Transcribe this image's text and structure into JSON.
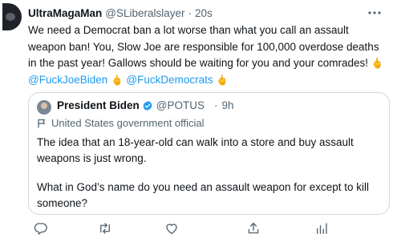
{
  "tweet": {
    "author_name": "UltraMagaMan",
    "author_handle": "@SLiberalslayer",
    "separator": "·",
    "timestamp": "20s",
    "text_main": "We need a Democrat ban a lot worse than what you call an assault weapon ban! You, Slow Joe are responsible for 100,000 overdose deaths in the past year! Gallows should be waiting for you and your comrades! ",
    "emoji_1": "🖕",
    "mention_1": "@FuckJoeBiden",
    "emoji_2": "🖕",
    "mention_2": "@FuckDemocrats",
    "emoji_3": "🖕"
  },
  "quoted": {
    "author_name": "President Biden",
    "author_handle": "@POTUS",
    "separator": "·",
    "timestamp": "9h",
    "label": "United States government official",
    "paragraph_1": "The idea that an 18-year-old can walk into a store and buy assault weapons is just wrong.",
    "paragraph_2": "What in God’s name do you need an assault weapon for except to kill someone?"
  },
  "icons": {
    "more": "more-horizontal-icon",
    "verified": "verified-badge-icon",
    "government_label": "flag-icon",
    "reply": "reply-icon",
    "retweet": "retweet-icon",
    "like": "like-icon",
    "share": "share-icon",
    "analytics": "analytics-icon"
  },
  "colors": {
    "text": "#0f1419",
    "muted": "#536471",
    "link": "#1d9bf0",
    "verified": "#1d9bf0",
    "border": "#cfd9de"
  }
}
